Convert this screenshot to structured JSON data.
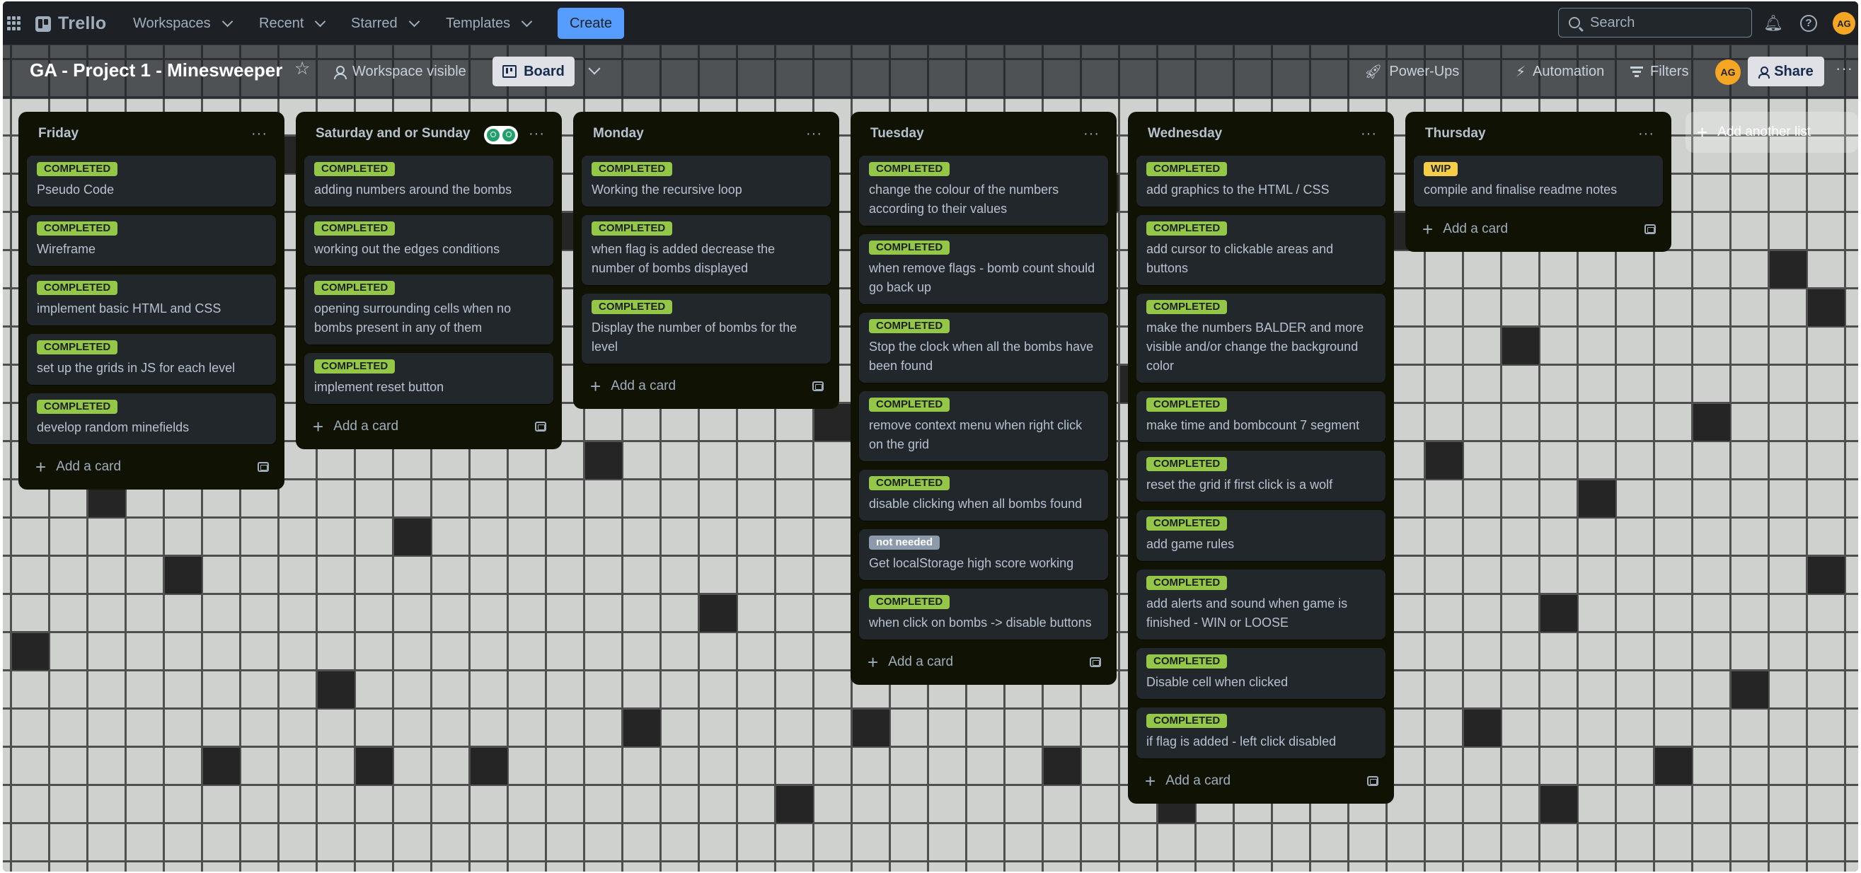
{
  "topnav": {
    "brand": "Trello",
    "menus": [
      {
        "label": "Workspaces"
      },
      {
        "label": "Recent"
      },
      {
        "label": "Starred"
      },
      {
        "label": "Templates"
      }
    ],
    "create_label": "Create",
    "search_placeholder": "Search",
    "avatar_initials": "AG"
  },
  "board": {
    "title": "GA - Project 1 - Minesweeper",
    "visibility": "Workspace visible",
    "view": "Board",
    "powerups": "Power-Ups",
    "automation": "Automation",
    "filters": "Filters",
    "avatar_initials": "AG",
    "share": "Share"
  },
  "colors": {
    "completed_label": "#94c748",
    "wip_label": "#f5cd47",
    "not_needed_label": "#8c9bab",
    "list_bg": "#101204",
    "card_bg": "#22272b"
  },
  "lists": [
    {
      "title": "Friday",
      "cards": [
        {
          "label": "COMPLETED",
          "text": "Pseudo Code"
        },
        {
          "label": "COMPLETED",
          "text": "Wireframe"
        },
        {
          "label": "COMPLETED",
          "text": "implement basic HTML and CSS"
        },
        {
          "label": "COMPLETED",
          "text": "set up the grids in JS for each level"
        },
        {
          "label": "COMPLETED",
          "text": "develop random minefields"
        }
      ],
      "add_card": "Add a card"
    },
    {
      "title": "Saturday and or Sunday",
      "cards": [
        {
          "label": "COMPLETED",
          "text": "adding numbers around the bombs"
        },
        {
          "label": "COMPLETED",
          "text": "working out the edges conditions"
        },
        {
          "label": "COMPLETED",
          "text": "opening surrounding cells when no bombs present in any of them"
        },
        {
          "label": "COMPLETED",
          "text": "implement reset button"
        }
      ],
      "add_card": "Add a card"
    },
    {
      "title": "Monday",
      "cards": [
        {
          "label": "COMPLETED",
          "text": "Working the recursive loop"
        },
        {
          "label": "COMPLETED",
          "text": "when flag is added decrease the number of bombs displayed"
        },
        {
          "label": "COMPLETED",
          "text": "Display the number of bombs for the level"
        }
      ],
      "add_card": "Add a card"
    },
    {
      "title": "Tuesday",
      "cards": [
        {
          "label": "COMPLETED",
          "text": "change the colour of the numbers according to their values"
        },
        {
          "label": "COMPLETED",
          "text": "when remove flags - bomb count should go back up"
        },
        {
          "label": "COMPLETED",
          "text": "Stop the clock when all the bombs have been found"
        },
        {
          "label": "COMPLETED",
          "text": "remove context menu when right click on the grid"
        },
        {
          "label": "COMPLETED",
          "text": "disable clicking when all bombs found"
        },
        {
          "label": "not needed",
          "text": "Get localStorage high score working"
        },
        {
          "label": "COMPLETED",
          "text": "when click on bombs -> disable buttons"
        }
      ],
      "add_card": "Add a card"
    },
    {
      "title": "Wednesday",
      "cards": [
        {
          "label": "COMPLETED",
          "text": "add graphics to the HTML / CSS"
        },
        {
          "label": "COMPLETED",
          "text": "add cursor to clickable areas and buttons"
        },
        {
          "label": "COMPLETED",
          "text": "make the numbers BALDER and more visible and/or change the background color"
        },
        {
          "label": "COMPLETED",
          "text": "make time and bombcount 7 segment"
        },
        {
          "label": "COMPLETED",
          "text": "reset the grid if first click is a wolf"
        },
        {
          "label": "COMPLETED",
          "text": "add game rules"
        },
        {
          "label": "COMPLETED",
          "text": "add alerts and sound when game is finished - WIN or LOOSE"
        },
        {
          "label": "COMPLETED",
          "text": "Disable cell when clicked"
        },
        {
          "label": "COMPLETED",
          "text": "if flag is added - left click disabled"
        }
      ],
      "add_card": "Add a card"
    },
    {
      "title": "Thursday",
      "cards": [
        {
          "label": "WIP",
          "text": "compile and finalise readme notes"
        }
      ],
      "add_card": "Add a card"
    }
  ],
  "add_list": "Add another list"
}
